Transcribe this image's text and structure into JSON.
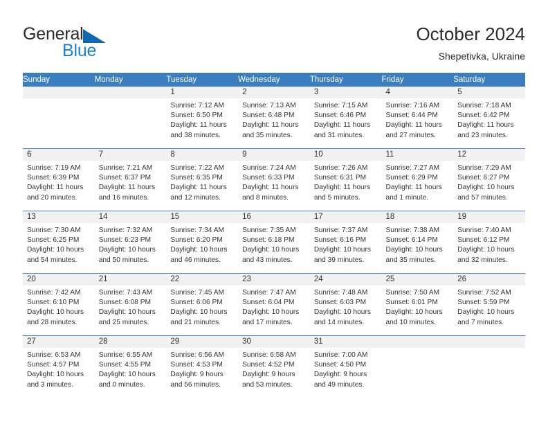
{
  "brand": {
    "word1": "General",
    "word2": "Blue",
    "triangle_color": "#1068b3",
    "blue_color": "#1b7fd1"
  },
  "header": {
    "month_title": "October 2024",
    "location": "Shepetivka, Ukraine"
  },
  "theme": {
    "header_bg": "#3a7ebf",
    "header_text": "#ffffff",
    "daynum_band": "#f1f1f1",
    "row_divider": "#4a82bd",
    "body_text": "#333333"
  },
  "calendar": {
    "weekday_headers": [
      "Sunday",
      "Monday",
      "Tuesday",
      "Wednesday",
      "Thursday",
      "Friday",
      "Saturday"
    ],
    "weeks": [
      [
        {
          "day": "",
          "sunrise": "",
          "sunset": "",
          "daylight_line1": "",
          "daylight_line2": ""
        },
        {
          "day": "",
          "sunrise": "",
          "sunset": "",
          "daylight_line1": "",
          "daylight_line2": ""
        },
        {
          "day": "1",
          "sunrise": "Sunrise: 7:12 AM",
          "sunset": "Sunset: 6:50 PM",
          "daylight_line1": "Daylight: 11 hours",
          "daylight_line2": "and 38 minutes."
        },
        {
          "day": "2",
          "sunrise": "Sunrise: 7:13 AM",
          "sunset": "Sunset: 6:48 PM",
          "daylight_line1": "Daylight: 11 hours",
          "daylight_line2": "and 35 minutes."
        },
        {
          "day": "3",
          "sunrise": "Sunrise: 7:15 AM",
          "sunset": "Sunset: 6:46 PM",
          "daylight_line1": "Daylight: 11 hours",
          "daylight_line2": "and 31 minutes."
        },
        {
          "day": "4",
          "sunrise": "Sunrise: 7:16 AM",
          "sunset": "Sunset: 6:44 PM",
          "daylight_line1": "Daylight: 11 hours",
          "daylight_line2": "and 27 minutes."
        },
        {
          "day": "5",
          "sunrise": "Sunrise: 7:18 AM",
          "sunset": "Sunset: 6:42 PM",
          "daylight_line1": "Daylight: 11 hours",
          "daylight_line2": "and 23 minutes."
        }
      ],
      [
        {
          "day": "6",
          "sunrise": "Sunrise: 7:19 AM",
          "sunset": "Sunset: 6:39 PM",
          "daylight_line1": "Daylight: 11 hours",
          "daylight_line2": "and 20 minutes."
        },
        {
          "day": "7",
          "sunrise": "Sunrise: 7:21 AM",
          "sunset": "Sunset: 6:37 PM",
          "daylight_line1": "Daylight: 11 hours",
          "daylight_line2": "and 16 minutes."
        },
        {
          "day": "8",
          "sunrise": "Sunrise: 7:22 AM",
          "sunset": "Sunset: 6:35 PM",
          "daylight_line1": "Daylight: 11 hours",
          "daylight_line2": "and 12 minutes."
        },
        {
          "day": "9",
          "sunrise": "Sunrise: 7:24 AM",
          "sunset": "Sunset: 6:33 PM",
          "daylight_line1": "Daylight: 11 hours",
          "daylight_line2": "and 8 minutes."
        },
        {
          "day": "10",
          "sunrise": "Sunrise: 7:26 AM",
          "sunset": "Sunset: 6:31 PM",
          "daylight_line1": "Daylight: 11 hours",
          "daylight_line2": "and 5 minutes."
        },
        {
          "day": "11",
          "sunrise": "Sunrise: 7:27 AM",
          "sunset": "Sunset: 6:29 PM",
          "daylight_line1": "Daylight: 11 hours",
          "daylight_line2": "and 1 minute."
        },
        {
          "day": "12",
          "sunrise": "Sunrise: 7:29 AM",
          "sunset": "Sunset: 6:27 PM",
          "daylight_line1": "Daylight: 10 hours",
          "daylight_line2": "and 57 minutes."
        }
      ],
      [
        {
          "day": "13",
          "sunrise": "Sunrise: 7:30 AM",
          "sunset": "Sunset: 6:25 PM",
          "daylight_line1": "Daylight: 10 hours",
          "daylight_line2": "and 54 minutes."
        },
        {
          "day": "14",
          "sunrise": "Sunrise: 7:32 AM",
          "sunset": "Sunset: 6:23 PM",
          "daylight_line1": "Daylight: 10 hours",
          "daylight_line2": "and 50 minutes."
        },
        {
          "day": "15",
          "sunrise": "Sunrise: 7:34 AM",
          "sunset": "Sunset: 6:20 PM",
          "daylight_line1": "Daylight: 10 hours",
          "daylight_line2": "and 46 minutes."
        },
        {
          "day": "16",
          "sunrise": "Sunrise: 7:35 AM",
          "sunset": "Sunset: 6:18 PM",
          "daylight_line1": "Daylight: 10 hours",
          "daylight_line2": "and 43 minutes."
        },
        {
          "day": "17",
          "sunrise": "Sunrise: 7:37 AM",
          "sunset": "Sunset: 6:16 PM",
          "daylight_line1": "Daylight: 10 hours",
          "daylight_line2": "and 39 minutes."
        },
        {
          "day": "18",
          "sunrise": "Sunrise: 7:38 AM",
          "sunset": "Sunset: 6:14 PM",
          "daylight_line1": "Daylight: 10 hours",
          "daylight_line2": "and 35 minutes."
        },
        {
          "day": "19",
          "sunrise": "Sunrise: 7:40 AM",
          "sunset": "Sunset: 6:12 PM",
          "daylight_line1": "Daylight: 10 hours",
          "daylight_line2": "and 32 minutes."
        }
      ],
      [
        {
          "day": "20",
          "sunrise": "Sunrise: 7:42 AM",
          "sunset": "Sunset: 6:10 PM",
          "daylight_line1": "Daylight: 10 hours",
          "daylight_line2": "and 28 minutes."
        },
        {
          "day": "21",
          "sunrise": "Sunrise: 7:43 AM",
          "sunset": "Sunset: 6:08 PM",
          "daylight_line1": "Daylight: 10 hours",
          "daylight_line2": "and 25 minutes."
        },
        {
          "day": "22",
          "sunrise": "Sunrise: 7:45 AM",
          "sunset": "Sunset: 6:06 PM",
          "daylight_line1": "Daylight: 10 hours",
          "daylight_line2": "and 21 minutes."
        },
        {
          "day": "23",
          "sunrise": "Sunrise: 7:47 AM",
          "sunset": "Sunset: 6:04 PM",
          "daylight_line1": "Daylight: 10 hours",
          "daylight_line2": "and 17 minutes."
        },
        {
          "day": "24",
          "sunrise": "Sunrise: 7:48 AM",
          "sunset": "Sunset: 6:03 PM",
          "daylight_line1": "Daylight: 10 hours",
          "daylight_line2": "and 14 minutes."
        },
        {
          "day": "25",
          "sunrise": "Sunrise: 7:50 AM",
          "sunset": "Sunset: 6:01 PM",
          "daylight_line1": "Daylight: 10 hours",
          "daylight_line2": "and 10 minutes."
        },
        {
          "day": "26",
          "sunrise": "Sunrise: 7:52 AM",
          "sunset": "Sunset: 5:59 PM",
          "daylight_line1": "Daylight: 10 hours",
          "daylight_line2": "and 7 minutes."
        }
      ],
      [
        {
          "day": "27",
          "sunrise": "Sunrise: 6:53 AM",
          "sunset": "Sunset: 4:57 PM",
          "daylight_line1": "Daylight: 10 hours",
          "daylight_line2": "and 3 minutes."
        },
        {
          "day": "28",
          "sunrise": "Sunrise: 6:55 AM",
          "sunset": "Sunset: 4:55 PM",
          "daylight_line1": "Daylight: 10 hours",
          "daylight_line2": "and 0 minutes."
        },
        {
          "day": "29",
          "sunrise": "Sunrise: 6:56 AM",
          "sunset": "Sunset: 4:53 PM",
          "daylight_line1": "Daylight: 9 hours",
          "daylight_line2": "and 56 minutes."
        },
        {
          "day": "30",
          "sunrise": "Sunrise: 6:58 AM",
          "sunset": "Sunset: 4:52 PM",
          "daylight_line1": "Daylight: 9 hours",
          "daylight_line2": "and 53 minutes."
        },
        {
          "day": "31",
          "sunrise": "Sunrise: 7:00 AM",
          "sunset": "Sunset: 4:50 PM",
          "daylight_line1": "Daylight: 9 hours",
          "daylight_line2": "and 49 minutes."
        },
        {
          "day": "",
          "sunrise": "",
          "sunset": "",
          "daylight_line1": "",
          "daylight_line2": ""
        },
        {
          "day": "",
          "sunrise": "",
          "sunset": "",
          "daylight_line1": "",
          "daylight_line2": ""
        }
      ]
    ]
  }
}
